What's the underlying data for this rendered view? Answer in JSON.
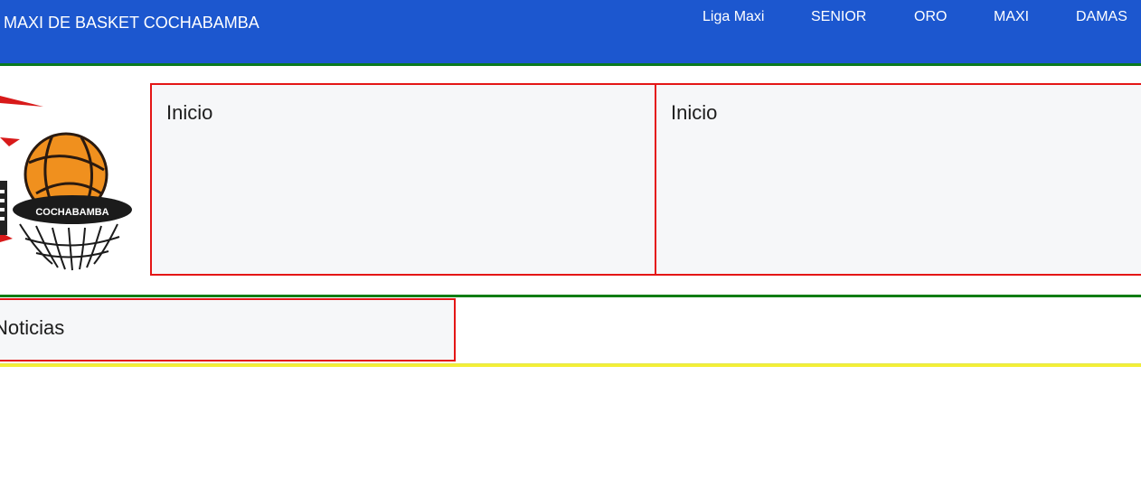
{
  "header": {
    "brand": "MAXI DE BASKET COCHABAMBA",
    "nav": [
      "Liga Maxi",
      "SENIOR",
      "ORO",
      "MAXI",
      "DAMAS"
    ]
  },
  "logo": {
    "text": "COCHABAMBA"
  },
  "cards": [
    {
      "title": "Inicio"
    },
    {
      "title": "Inicio"
    }
  ],
  "news": {
    "title": "Noticias"
  },
  "colors": {
    "header_bg": "#1c57cf",
    "header_border": "#0a7a1e",
    "card_border": "#e41616",
    "band_top": "#0d7d14",
    "band_bottom": "#f4ef37",
    "ball": "#f0901e"
  }
}
